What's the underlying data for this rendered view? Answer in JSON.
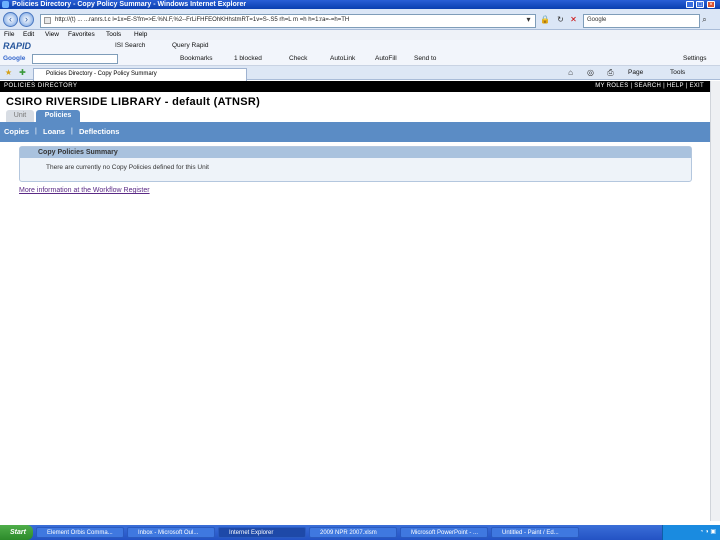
{
  "window": {
    "title": "Policies Directory - Copy Policy Summary - Windows Internet Explorer"
  },
  "browser": {
    "address": "http://(t) ...  ...ranrs.t.c l=1x=E-S'fm=>E.%N.F,%2--FrLiFHFEOhKHhstmRT=1v=S-.S5 rh=L m =h h=1:ra=-=h=TH",
    "search_placeholder": "Google",
    "menu": [
      "File",
      "Edit",
      "View",
      "Favorites",
      "Tools",
      "Help"
    ],
    "rapid_toolbar": {
      "logo": "RAPID",
      "search_label": "ISI Search",
      "quick_label": "Query Rapid"
    },
    "google_toolbar": {
      "logo": "Google",
      "items": [
        "Bookmarks",
        "1 blocked",
        "Check",
        "AutoLink",
        "AutoFill",
        "Send to"
      ],
      "settings": "Settings"
    },
    "tab_title": "Policies Directory - Copy Policy Summary",
    "right_tools": [
      "Page",
      "Tools"
    ]
  },
  "page": {
    "topbar_brand": "POLICIES DIRECTORY",
    "topbar_links": "MY ROLES  |  SEARCH  |  HELP  |  EXIT",
    "heading": "CSIRO RIVERSIDE LIBRARY - default (ATNSR)",
    "tabs": [
      "Unit",
      "Policies"
    ],
    "subnav": [
      "Copies",
      "Loans",
      "Deflections"
    ],
    "panel_title": "Copy Policies Summary",
    "panel_message": "There are currently no Copy Policies defined for this Unit",
    "more_info_link": "More information at the Workflow Register"
  },
  "taskbar": {
    "start": "Start",
    "tasks": [
      "Element Orbis Comma...",
      "Inbox - Microsoft Oul...",
      "Internet Explorer",
      "2009 NPR 2007.xlsm",
      "Microsoft PowerPoint - ...",
      "Untitled - Paint / Ed..."
    ],
    "active_index": 2
  },
  "colors": {
    "accent": "#5b8cc5",
    "topbar": "#000000",
    "link": "#5b2a86"
  }
}
